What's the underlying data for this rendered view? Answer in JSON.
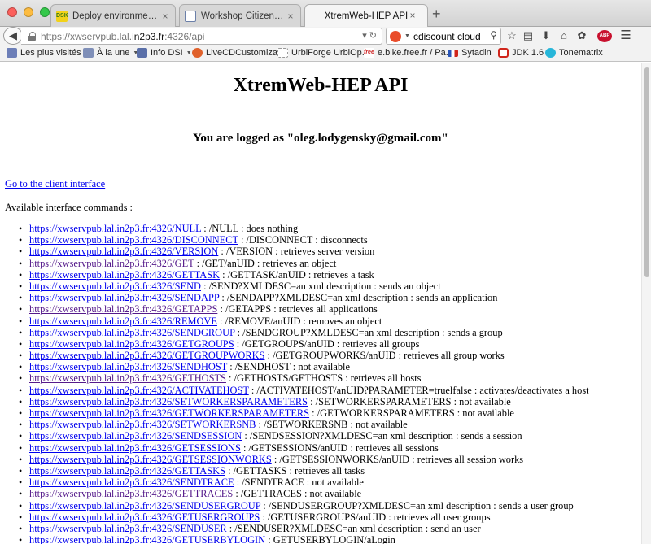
{
  "tabs": [
    {
      "label": "Deploy environment--OAR...",
      "close": "×"
    },
    {
      "label": "Workshop Citizen Science ...",
      "close": "×"
    },
    {
      "label": "XtremWeb-HEP API",
      "close": "×"
    }
  ],
  "newtab_label": "+",
  "nav": {
    "back_glyph": "◀",
    "url_prefix": "https://xwservpub.lal.",
    "url_domain": "in2p3.fr",
    "url_suffix": ":4326/api",
    "url_actions": "▾ ↻",
    "search_value": "cdiscount cloud",
    "search_glyph": "⚲"
  },
  "bookmarks": [
    {
      "label": "Les plus visités",
      "dropdown": true,
      "color": "#6d7fb8"
    },
    {
      "label": "À la une",
      "dropdown": true,
      "color": "#7f8fb8"
    },
    {
      "label": "Info DSI",
      "dropdown": true,
      "color": "#5a6fa8"
    },
    {
      "label": "LiveCDCustomiza...",
      "dropdown": false,
      "color": "#e0612b"
    },
    {
      "label": "UrbiForge UrbiOp...",
      "dropdown": false,
      "color": "#ffffff"
    },
    {
      "label": "e.bike.free.fr / Pa...",
      "dropdown": false,
      "color": "#cc1f1f"
    },
    {
      "label": "Sytadin",
      "dropdown": false,
      "color": "#2a56b8"
    },
    {
      "label": "JDK 1.6",
      "dropdown": false,
      "color": "#d0261c"
    },
    {
      "label": "Tonematrix",
      "dropdown": false,
      "color": "#27b6d9"
    }
  ],
  "page": {
    "title": "XtremWeb-HEP API",
    "logged": "You are logged as \"oleg.lodygensky@gmail.com\"",
    "client_link": "Go to the client interface",
    "available": "Available interface commands :",
    "commands": [
      {
        "link": "https://xwservpub.lal.in2p3.fr:4326/NULL",
        "desc": " : /NULL : does nothing",
        "visited": false
      },
      {
        "link": "https://xwservpub.lal.in2p3.fr:4326/DISCONNECT",
        "desc": " : /DISCONNECT : disconnects",
        "visited": false
      },
      {
        "link": "https://xwservpub.lal.in2p3.fr:4326/VERSION",
        "desc": " : /VERSION : retrieves server version",
        "visited": false
      },
      {
        "link": "https://xwservpub.lal.in2p3.fr:4326/GET",
        "desc": " : /GET/anUID : retrieves an object",
        "visited": true
      },
      {
        "link": "https://xwservpub.lal.in2p3.fr:4326/GETTASK",
        "desc": " : /GETTASK/anUID : retrieves a task",
        "visited": false
      },
      {
        "link": "https://xwservpub.lal.in2p3.fr:4326/SEND",
        "desc": " : /SEND?XMLDESC=an xml description : sends an object",
        "visited": false
      },
      {
        "link": "https://xwservpub.lal.in2p3.fr:4326/SENDAPP",
        "desc": " : /SENDAPP?XMLDESC=an xml description : sends an application",
        "visited": false
      },
      {
        "link": "https://xwservpub.lal.in2p3.fr:4326/GETAPPS",
        "desc": " : /GETAPPS : retrieves all applications",
        "visited": true
      },
      {
        "link": "https://xwservpub.lal.in2p3.fr:4326/REMOVE",
        "desc": " : /REMOVE/anUID : removes an object",
        "visited": false
      },
      {
        "link": "https://xwservpub.lal.in2p3.fr:4326/SENDGROUP",
        "desc": " : /SENDGROUP?XMLDESC=an xml description : sends a group",
        "visited": false
      },
      {
        "link": "https://xwservpub.lal.in2p3.fr:4326/GETGROUPS",
        "desc": " : /GETGROUPS/anUID : retrieves all groups",
        "visited": false
      },
      {
        "link": "https://xwservpub.lal.in2p3.fr:4326/GETGROUPWORKS",
        "desc": " : /GETGROUPWORKS/anUID : retrieves all group works",
        "visited": false
      },
      {
        "link": "https://xwservpub.lal.in2p3.fr:4326/SENDHOST",
        "desc": " : /SENDHOST : not available",
        "visited": false
      },
      {
        "link": "https://xwservpub.lal.in2p3.fr:4326/GETHOSTS",
        "desc": " : /GETHOSTS/GETHOSTS : retrieves all hosts",
        "visited": true
      },
      {
        "link": "https://xwservpub.lal.in2p3.fr:4326/ACTIVATEHOST",
        "desc": " : /ACTIVATEHOST/anUID?PARAMETER=truelfalse : activates/deactivates a host",
        "visited": false
      },
      {
        "link": "https://xwservpub.lal.in2p3.fr:4326/SETWORKERSPARAMETERS",
        "desc": " : /SETWORKERSPARAMETERS : not available",
        "visited": false
      },
      {
        "link": "https://xwservpub.lal.in2p3.fr:4326/GETWORKERSPARAMETERS",
        "desc": " : /GETWORKERSPARAMETERS : not available",
        "visited": false
      },
      {
        "link": "https://xwservpub.lal.in2p3.fr:4326/SETWORKERSNB",
        "desc": " : /SETWORKERSNB : not available",
        "visited": false
      },
      {
        "link": "https://xwservpub.lal.in2p3.fr:4326/SENDSESSION",
        "desc": " : /SENDSESSION?XMLDESC=an xml description : sends a session",
        "visited": false
      },
      {
        "link": "https://xwservpub.lal.in2p3.fr:4326/GETSESSIONS",
        "desc": " : /GETSESSIONS/anUID : retrieves all sessions",
        "visited": false
      },
      {
        "link": "https://xwservpub.lal.in2p3.fr:4326/GETSESSIONWORKS",
        "desc": " : /GETSESSIONWORKS/anUID : retrieves all session works",
        "visited": false
      },
      {
        "link": "https://xwservpub.lal.in2p3.fr:4326/GETTASKS",
        "desc": " : /GETTASKS : retrieves all tasks",
        "visited": false
      },
      {
        "link": "https://xwservpub.lal.in2p3.fr:4326/SENDTRACE",
        "desc": " : /SENDTRACE : not available",
        "visited": false
      },
      {
        "link": "https://xwservpub.lal.in2p3.fr:4326/GETTRACES",
        "desc": " : /GETTRACES : not available",
        "visited": true
      },
      {
        "link": "https://xwservpub.lal.in2p3.fr:4326/SENDUSERGROUP",
        "desc": " : /SENDUSERGROUP?XMLDESC=an xml description : sends a user group",
        "visited": false
      },
      {
        "link": "https://xwservpub.lal.in2p3.fr:4326/GETUSERGROUPS",
        "desc": " : /GETUSERGROUPS/anUID : retrieves all user groups",
        "visited": false
      },
      {
        "link": "https://xwservpub.lal.in2p3.fr:4326/SENDUSER",
        "desc": " : /SENDUSER?XMLDESC=an xml description : send an user",
        "visited": false
      },
      {
        "link": "https://xwservpub.lal.in2p3.fr:4326/GETUSERBYLOGIN",
        "desc": " : GETUSERBYLOGIN/aLogin",
        "visited": false
      }
    ]
  },
  "icons": {
    "reader": "▤",
    "star": "☆",
    "library": "▥",
    "download": "⬇",
    "home": "⌂",
    "sync": "✿",
    "adblock": "ABP",
    "menu": "☰"
  },
  "colors": {
    "link": "#0000ee",
    "visited": "#551a8b",
    "abp": "#c8102e",
    "close_red": "#fc605c",
    "minimize_yellow": "#fdbc40",
    "maximize_green": "#34c84a"
  }
}
